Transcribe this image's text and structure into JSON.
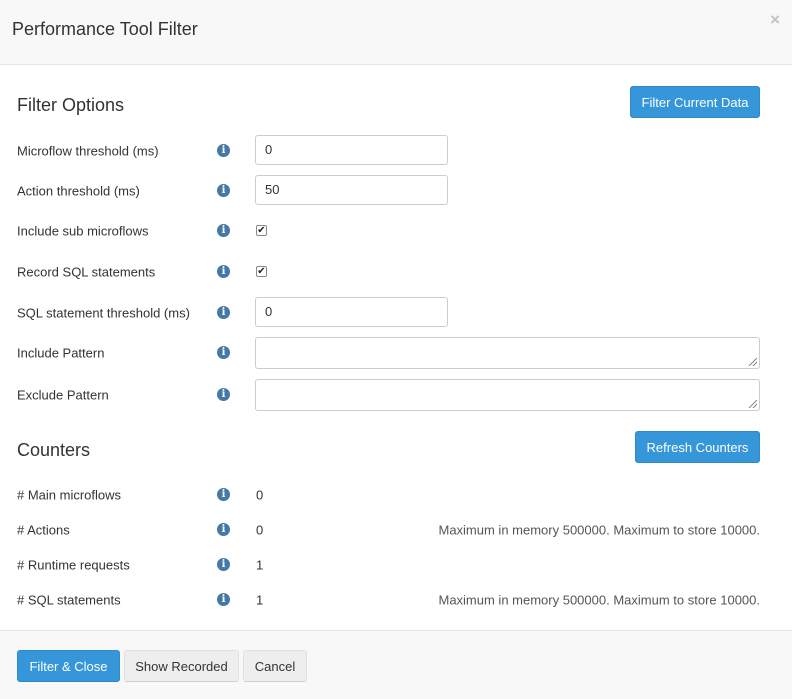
{
  "header": {
    "title": "Performance Tool Filter",
    "close_label": "×"
  },
  "filter_options": {
    "title": "Filter Options",
    "action_label": "Filter Current Data",
    "fields": {
      "microflow_threshold": {
        "label": "Microflow threshold (ms)",
        "value": "0"
      },
      "action_threshold": {
        "label": "Action threshold (ms)",
        "value": "50"
      },
      "include_sub_microflows": {
        "label": "Include sub microflows",
        "checked": true
      },
      "record_sql": {
        "label": "Record SQL statements",
        "checked": true
      },
      "sql_threshold": {
        "label": "SQL statement threshold (ms)",
        "value": "0"
      },
      "include_pattern": {
        "label": "Include Pattern",
        "value": ""
      },
      "exclude_pattern": {
        "label": "Exclude Pattern",
        "value": ""
      }
    }
  },
  "counters": {
    "title": "Counters",
    "action_label": "Refresh Counters",
    "rows": {
      "main_microflows": {
        "label": "# Main microflows",
        "value": "0",
        "note": ""
      },
      "actions": {
        "label": "# Actions",
        "value": "0",
        "note": "Maximum in memory 500000. Maximum to store 10000."
      },
      "runtime_requests": {
        "label": "# Runtime requests",
        "value": "1",
        "note": ""
      },
      "sql_statements": {
        "label": "# SQL statements",
        "value": "1",
        "note": "Maximum in memory 500000. Maximum to store 10000."
      }
    }
  },
  "footer": {
    "filter_close": "Filter & Close",
    "show_recorded": "Show Recorded",
    "cancel": "Cancel"
  },
  "info_icon_glyph": "i",
  "check_glyph": "✔",
  "colors": {
    "primary": "#3596da",
    "info_icon": "#4478a6",
    "header_bg": "#f8f8f8"
  }
}
